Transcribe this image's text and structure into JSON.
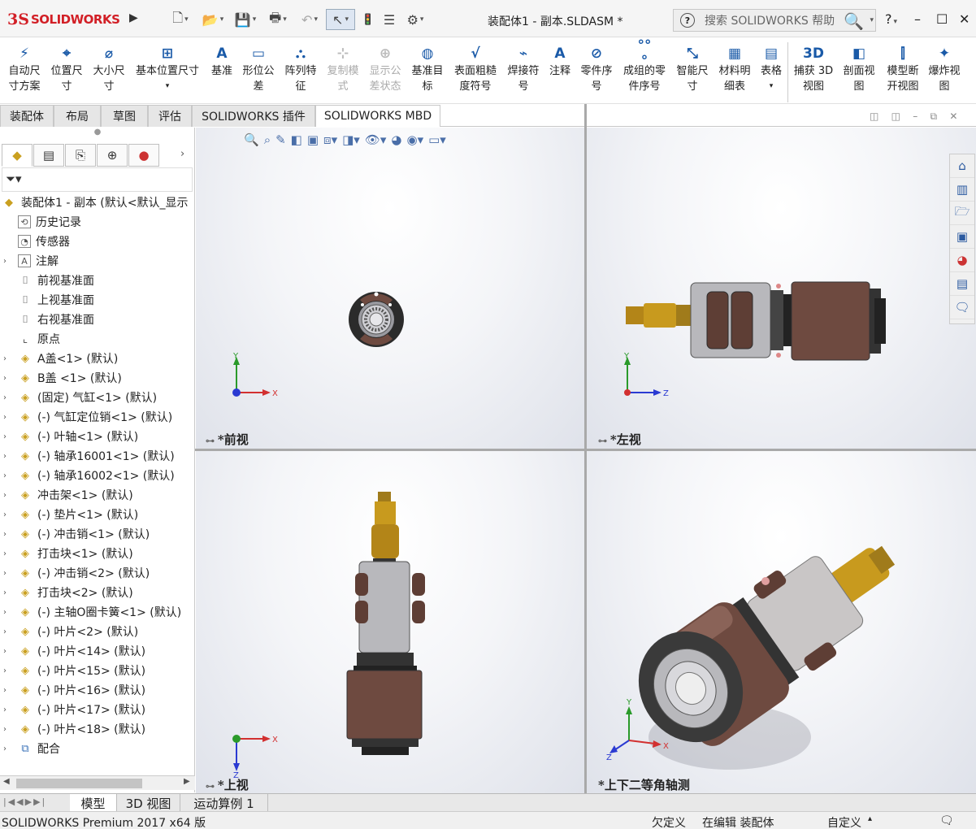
{
  "app": {
    "logo_mark": "3S",
    "logo_text": "SOLIDWORKS",
    "window_title": "装配体1 - 副本.SLDASM *"
  },
  "help_search": {
    "placeholder": "搜索 SOLIDWORKS 帮助"
  },
  "title_buttons": {
    "help": "?",
    "minimize": "–",
    "maximize": "☐",
    "close": "✕"
  },
  "ribbon": {
    "items": [
      {
        "icon": "auto-dimension-icon",
        "label": "自动尺\n寸方案",
        "enabled": true
      },
      {
        "icon": "location-dimension-icon",
        "label": "位置尺\n寸",
        "enabled": true
      },
      {
        "icon": "size-dimension-icon",
        "label": "大小尺\n寸",
        "enabled": true
      },
      {
        "icon": "basic-location-dimension-icon",
        "label": "基本位置尺寸",
        "enabled": true
      },
      {
        "icon": "datum-icon",
        "label": "基准",
        "enabled": true
      },
      {
        "icon": "geometric-tolerance-icon",
        "label": "形位公\n差",
        "enabled": true
      },
      {
        "icon": "pattern-feature-icon",
        "label": "阵列特\n征",
        "enabled": true
      },
      {
        "icon": "copy-scheme-icon",
        "label": "复制模\n式",
        "enabled": false
      },
      {
        "icon": "show-tolerance-status-icon",
        "label": "显示公\n差状态",
        "enabled": false
      },
      {
        "icon": "datum-target-icon",
        "label": "基准目\n标",
        "enabled": true
      },
      {
        "icon": "surface-finish-icon",
        "label": "表面粗糙\n度符号",
        "enabled": true
      },
      {
        "icon": "weld-symbol-icon",
        "label": "焊接符\n号",
        "enabled": true
      },
      {
        "icon": "note-icon",
        "label": "注释",
        "enabled": true
      },
      {
        "icon": "balloon-icon",
        "label": "零件序\n号",
        "enabled": true
      },
      {
        "icon": "stacked-balloon-icon",
        "label": "成组的零\n件序号",
        "enabled": true
      },
      {
        "icon": "smart-dimension-icon",
        "label": "智能尺\n寸",
        "enabled": true
      },
      {
        "icon": "bom-icon",
        "label": "材料明\n细表",
        "enabled": true
      },
      {
        "icon": "table-icon",
        "label": "表格",
        "enabled": true
      },
      {
        "icon": "capture-3d-view-icon",
        "label": "捕获 3D\n视图",
        "enabled": true
      },
      {
        "icon": "section-view-icon",
        "label": "剖面视\n图",
        "enabled": true
      },
      {
        "icon": "model-break-view-icon",
        "label": "模型断\n开视图",
        "enabled": true
      },
      {
        "icon": "exploded-view-icon",
        "label": "爆炸视\n图",
        "enabled": true
      }
    ]
  },
  "command_tabs": [
    {
      "label": "装配体",
      "active": false
    },
    {
      "label": "布局",
      "active": false
    },
    {
      "label": "草图",
      "active": false
    },
    {
      "label": "评估",
      "active": false
    },
    {
      "label": "SOLIDWORKS 插件",
      "active": false
    },
    {
      "label": "SOLIDWORKS MBD",
      "active": true
    }
  ],
  "feature_tree": {
    "root": "装配体1 - 副本  (默认<默认_显示",
    "items": [
      {
        "label": "历史记录",
        "icon": "history-icon",
        "expandable": false
      },
      {
        "label": "传感器",
        "icon": "sensor-icon",
        "expandable": false
      },
      {
        "label": "注解",
        "icon": "annotation-icon",
        "expandable": true
      },
      {
        "label": "前视基准面",
        "icon": "plane-icon",
        "expandable": false
      },
      {
        "label": "上视基准面",
        "icon": "plane-icon",
        "expandable": false
      },
      {
        "label": "右视基准面",
        "icon": "plane-icon",
        "expandable": false
      },
      {
        "label": "原点",
        "icon": "origin-icon",
        "expandable": false
      },
      {
        "label": "A盖<1> (默认)",
        "icon": "part-icon",
        "expandable": true
      },
      {
        "label": "B盖 <1> (默认)",
        "icon": "part-icon",
        "expandable": true
      },
      {
        "label": "(固定) 气缸<1> (默认)",
        "icon": "part-icon",
        "expandable": true
      },
      {
        "label": "(-) 气缸定位销<1> (默认)",
        "icon": "part-icon",
        "expandable": true
      },
      {
        "label": "(-) 叶轴<1> (默认)",
        "icon": "part-icon",
        "expandable": true
      },
      {
        "label": "(-) 轴承16001<1> (默认)",
        "icon": "part-icon",
        "expandable": true
      },
      {
        "label": "(-) 轴承16002<1> (默认)",
        "icon": "part-icon",
        "expandable": true
      },
      {
        "label": "冲击架<1> (默认)",
        "icon": "part-icon",
        "expandable": true
      },
      {
        "label": "(-) 垫片<1> (默认)",
        "icon": "part-icon",
        "expandable": true
      },
      {
        "label": "(-) 冲击销<1> (默认)",
        "icon": "part-icon",
        "expandable": true
      },
      {
        "label": "打击块<1> (默认)",
        "icon": "part-icon",
        "expandable": true
      },
      {
        "label": "(-) 冲击销<2> (默认)",
        "icon": "part-icon",
        "expandable": true
      },
      {
        "label": "打击块<2> (默认)",
        "icon": "part-icon",
        "expandable": true
      },
      {
        "label": "(-) 主轴O圈卡簧<1> (默认)",
        "icon": "part-icon",
        "expandable": true
      },
      {
        "label": "(-) 叶片<2> (默认)",
        "icon": "part-icon",
        "expandable": true
      },
      {
        "label": "(-) 叶片<14> (默认)",
        "icon": "part-icon",
        "expandable": true
      },
      {
        "label": "(-) 叶片<15> (默认)",
        "icon": "part-icon",
        "expandable": true
      },
      {
        "label": "(-) 叶片<16> (默认)",
        "icon": "part-icon",
        "expandable": true
      },
      {
        "label": "(-) 叶片<17> (默认)",
        "icon": "part-icon",
        "expandable": true
      },
      {
        "label": "(-) 叶片<18> (默认)",
        "icon": "part-icon",
        "expandable": true
      },
      {
        "label": "配合",
        "icon": "mates-icon",
        "expandable": true
      }
    ]
  },
  "viewports": {
    "front": {
      "name": "*前视",
      "axes": [
        "Y",
        "X"
      ]
    },
    "left": {
      "name": "*左视",
      "axes": [
        "Y",
        "Z"
      ]
    },
    "top": {
      "name": "*上视",
      "axes": [
        "X",
        "Z"
      ]
    },
    "iso": {
      "name": "*上下二等角轴测",
      "axes": [
        "Y",
        "X",
        "Z"
      ]
    }
  },
  "bottom_tabs": [
    {
      "label": "模型",
      "active": true
    },
    {
      "label": "3D 视图",
      "active": false
    },
    {
      "label": "运动算例 1",
      "active": false
    }
  ],
  "status_bar": {
    "product": "SOLIDWORKS Premium 2017 x64 版",
    "definition": "欠定义",
    "mode": "在编辑 装配体",
    "units": "自定义"
  },
  "colors": {
    "brand": "#d21f26",
    "accent": "#1a5aa8",
    "brass": "#c89a1e",
    "housing_brown": "#6e4a40",
    "steel": "#b8b8bc"
  }
}
